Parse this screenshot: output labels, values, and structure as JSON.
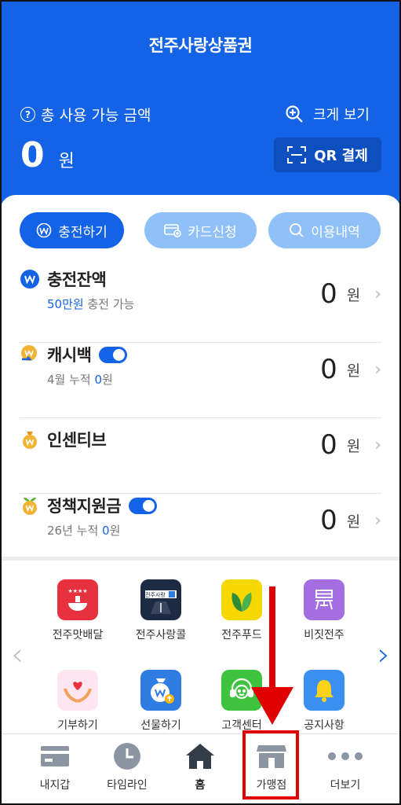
{
  "header": {
    "title": "전주사랑상품권",
    "available_label": "총 사용 가능 금액",
    "zoom_label": "크게 보기",
    "balance_amount": "0",
    "balance_unit": "원",
    "qr_label": "QR 결제"
  },
  "actions": {
    "charge": "충전하기",
    "card_apply": "카드신청",
    "history": "이용내역"
  },
  "rows": [
    {
      "title": "충전잔액",
      "sub_highlight": "50만원",
      "sub_text": " 충전 가능",
      "amount": "0",
      "unit": "원",
      "toggle": false
    },
    {
      "title": "캐시백",
      "sub_text": "4월 누적 ",
      "sub_highlight": "0",
      "sub_after": "원",
      "amount": "0",
      "unit": "원",
      "toggle": true
    },
    {
      "title": "인센티브",
      "amount": "0",
      "unit": "원",
      "toggle": false
    },
    {
      "title": "정책지원금",
      "sub_text": "26년 누적 ",
      "sub_highlight": "0",
      "sub_after": "원",
      "amount": "0",
      "unit": "원",
      "toggle": true
    }
  ],
  "menu": [
    {
      "label": "전주맛배달",
      "icon": "food-delivery-icon",
      "color": "#e8313f"
    },
    {
      "label": "전주사랑콜",
      "icon": "taxi-call-icon",
      "color": "#1d2a44"
    },
    {
      "label": "전주푸드",
      "icon": "leaf-food-icon",
      "color": "#f5d800"
    },
    {
      "label": "비짓전주",
      "icon": "visit-jeonju-icon",
      "color": "#a46ee0"
    },
    {
      "label": "기부하기",
      "icon": "donate-heart-icon",
      "color": "#fde6ef"
    },
    {
      "label": "선물하기",
      "icon": "gift-money-icon",
      "color": "#2f7de3"
    },
    {
      "label": "고객센터",
      "icon": "customer-center-icon",
      "color": "#3ec33e"
    },
    {
      "label": "공지사항",
      "icon": "notice-bell-icon",
      "color": "#3b8ff0"
    }
  ],
  "menu_inner_text": "전주사랑",
  "nav": [
    {
      "label": "내지갑",
      "icon": "wallet-icon"
    },
    {
      "label": "타임라인",
      "icon": "clock-icon"
    },
    {
      "label": "홈",
      "icon": "home-icon"
    },
    {
      "label": "가맹점",
      "icon": "store-icon"
    },
    {
      "label": "더보기",
      "icon": "more-dots-icon"
    }
  ],
  "colors": {
    "primary": "#1463e6",
    "pill_light": "#8fc0f7",
    "annotation_red": "#e00000"
  }
}
